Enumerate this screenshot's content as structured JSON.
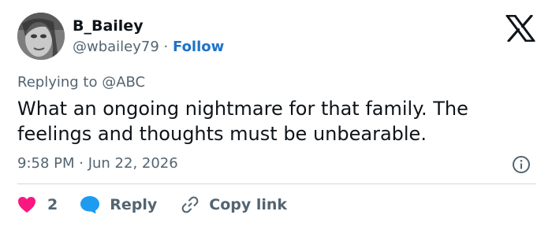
{
  "author": {
    "display_name": "B_Bailey",
    "handle": "@wbailey79",
    "separator": "·",
    "follow_label": "Follow",
    "avatar_icon": "user-photo-avatar"
  },
  "platform_logo": "x-logo-icon",
  "reply_context": "Replying to @ABC",
  "tweet": {
    "text": "What an ongoing nightmare for that family. The feelings and thoughts must be unbearable.",
    "timestamp": "9:58 PM · Jun 22, 2026"
  },
  "actions": {
    "like_count": "2",
    "reply_label": "Reply",
    "copy_link_label": "Copy link"
  },
  "colors": {
    "link_blue": "#1d73c9",
    "like_pink": "#f91880",
    "reply_blue": "#1d9bf0",
    "muted_text": "#536471",
    "divider": "#cfd9de"
  }
}
